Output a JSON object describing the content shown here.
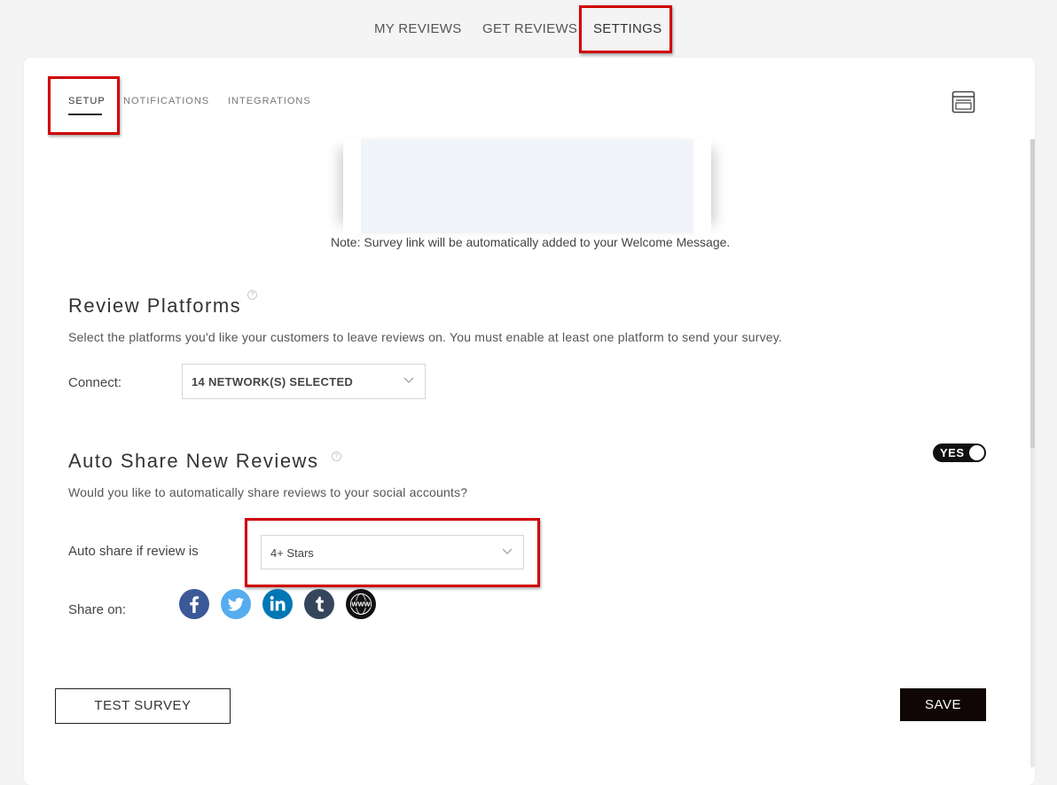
{
  "top_nav": {
    "items": [
      {
        "label": "MY REVIEWS"
      },
      {
        "label": "GET REVIEWS"
      },
      {
        "label": "SETTINGS",
        "active": true
      }
    ]
  },
  "sub_tabs": [
    {
      "label": "SETUP",
      "active": true
    },
    {
      "label": "NOTIFICATIONS"
    },
    {
      "label": "INTEGRATIONS"
    }
  ],
  "preview": {
    "icon": "browser-window-icon",
    "note": "Note: Survey link will be automatically added to your Welcome Message."
  },
  "review_platforms": {
    "title": "Review Platforms",
    "help_icon": "question-circle-icon",
    "description": "Select the platforms you'd like your customers to leave reviews on. You must enable at least one platform to send your survey.",
    "connect_label": "Connect:",
    "connect_value": "14 NETWORK(S) SELECTED"
  },
  "auto_share": {
    "title": "Auto Share New Reviews",
    "help_icon": "question-circle-icon",
    "toggle_label": "YES",
    "toggle_on": true,
    "description": "Would you like to automatically share reviews to your social accounts?",
    "threshold_label": "Auto share if review is",
    "threshold_value": "4+ Stars",
    "share_on_label": "Share on:",
    "networks": [
      {
        "icon": "facebook-icon",
        "color": "#3b5998"
      },
      {
        "icon": "twitter-icon",
        "color": "#55acee"
      },
      {
        "icon": "linkedin-icon",
        "color": "#0077b5"
      },
      {
        "icon": "tumblr-icon",
        "color": "#35465c"
      },
      {
        "icon": "website-icon",
        "color": "#111111"
      }
    ]
  },
  "actions": {
    "test_survey": "TEST SURVEY",
    "save": "SAVE"
  },
  "colors": {
    "highlight": "#d00000",
    "save_button": "#110606",
    "toggle": "#111111"
  }
}
